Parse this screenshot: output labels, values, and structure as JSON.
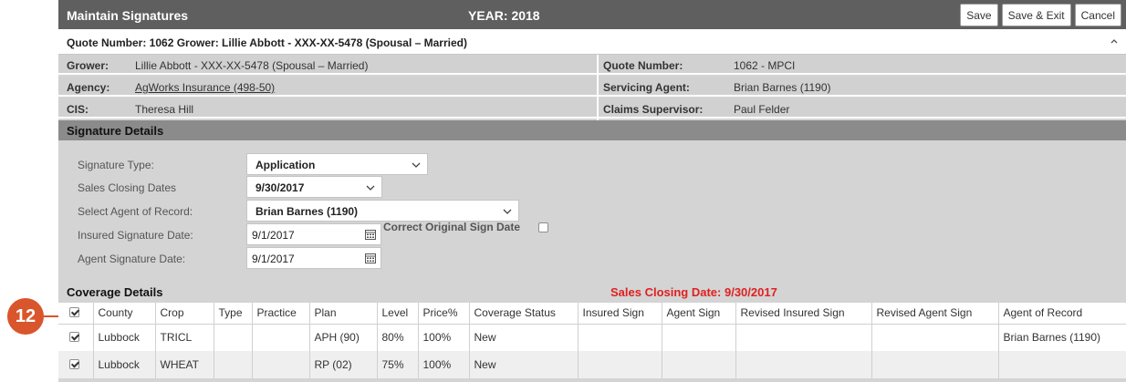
{
  "callout": {
    "number": "12",
    "color": "#d9552b"
  },
  "header": {
    "title": "Maintain Signatures",
    "year": "YEAR: 2018",
    "buttons": {
      "save": "Save",
      "save_exit": "Save & Exit",
      "cancel": "Cancel"
    }
  },
  "quote_bar": {
    "text": "Quote Number: 1062 Grower: Lillie Abbott - XXX-XX-5478 (Spousal – Married)"
  },
  "info": {
    "grower_label": "Grower:",
    "grower_value": "Lillie Abbott - XXX-XX-5478 (Spousal – Married)",
    "agency_label": "Agency:",
    "agency_value": "AgWorks Insurance (498-50)",
    "cis_label": "CIS:",
    "cis_value": "Theresa Hill",
    "quote_label": "Quote Number:",
    "quote_value": "1062 - MPCI",
    "servicing_label": "Servicing Agent:",
    "servicing_value": "Brian Barnes (1190)",
    "claims_label": "Claims Supervisor:",
    "claims_value": "Paul Felder"
  },
  "signature_details": {
    "title": "Signature Details",
    "signature_type_label": "Signature Type:",
    "signature_type_value": "Application",
    "sales_closing_label": "Sales Closing Dates",
    "sales_closing_value": "9/30/2017",
    "agent_record_label": "Select Agent of Record:",
    "agent_record_value": "Brian Barnes (1190)",
    "insured_sig_label": "Insured Signature Date:",
    "insured_sig_value": "9/1/2017",
    "correct_original_label": "Correct Original Sign Date",
    "agent_sig_label": "Agent Signature Date:",
    "agent_sig_value": "9/1/2017"
  },
  "coverage": {
    "title": "Coverage Details",
    "sales_closing": "Sales Closing Date: 9/30/2017",
    "sales_closing_color": "#e02020",
    "columns": [
      "County",
      "Crop",
      "Type",
      "Practice",
      "Plan",
      "Level",
      "Price%",
      "Coverage Status",
      "Insured Sign",
      "Agent Sign",
      "Revised Insured Sign",
      "Revised Agent Sign",
      "Agent of Record"
    ],
    "rows": [
      {
        "County": "Lubbock",
        "Crop": "TRICL",
        "Type": "",
        "Practice": "",
        "Plan": "APH (90)",
        "Level": "80%",
        "Price%": "100%",
        "Coverage Status": "New",
        "Insured Sign": "",
        "Agent Sign": "",
        "Revised Insured Sign": "",
        "Revised Agent Sign": "",
        "Agent of Record": "Brian Barnes (1190)"
      },
      {
        "County": "Lubbock",
        "Crop": "WHEAT",
        "Type": "",
        "Practice": "",
        "Plan": "RP (02)",
        "Level": "75%",
        "Price%": "100%",
        "Coverage Status": "New",
        "Insured Sign": "",
        "Agent Sign": "",
        "Revised Insured Sign": "",
        "Revised Agent Sign": "",
        "Agent of Record": ""
      }
    ]
  }
}
